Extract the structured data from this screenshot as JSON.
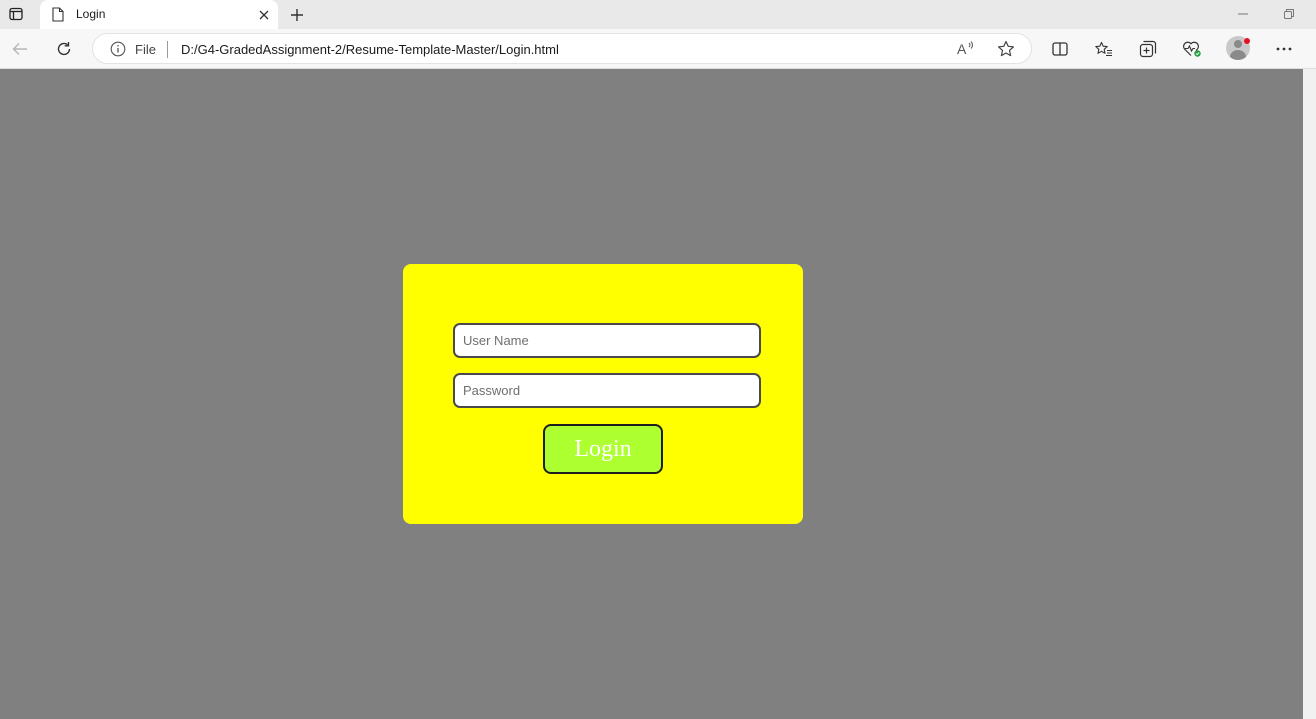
{
  "browser": {
    "tab": {
      "title": "Login",
      "icon": "page-icon"
    },
    "address_bar": {
      "scheme_label": "File",
      "url": "D:/G4-GradedAssignment-2/Resume-Template-Master/Login.html"
    },
    "icons": {
      "tab_actions": "tab-actions-icon",
      "close_tab": "close-icon",
      "new_tab": "plus-icon",
      "minimize": "minimize-icon",
      "restore": "restore-icon",
      "back": "back-arrow-icon",
      "refresh": "refresh-icon",
      "info": "info-icon",
      "read_aloud": "read-aloud-icon",
      "favorite": "star-icon",
      "split_screen": "split-screen-icon",
      "favorites": "favorites-icon",
      "collections": "collections-icon",
      "performance": "heart-pulse-icon",
      "profile": "avatar",
      "menu": "more-icon"
    }
  },
  "login_form": {
    "username_placeholder": "User Name",
    "password_placeholder": "Password",
    "submit_label": "Login"
  },
  "colors": {
    "page_background": "#808080",
    "card_background": "#ffff00",
    "button_background": "#adff2f",
    "button_text": "#ffffff",
    "notification_dot": "#e81123"
  }
}
